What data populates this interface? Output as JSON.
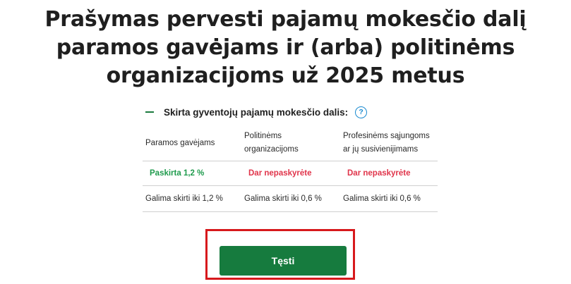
{
  "page": {
    "title_lines": [
      "Prašymas pervesti pajamų mokesčio dalį",
      "paramos gavėjams ir (arba) politinėms",
      "organizacijoms už 2025 metus"
    ]
  },
  "section": {
    "title": "Skirta gyventojų pajamų mokesčio dalis:",
    "help_icon_glyph": "?",
    "accent_color": "#1b7a3e"
  },
  "table": {
    "headers": [
      [
        "Paramos gavėjams"
      ],
      [
        "Politinėms",
        "organizacijoms"
      ],
      [
        "Profesinėms sąjungoms",
        "ar jų susivienijimams"
      ]
    ],
    "statuses": [
      {
        "text": "Paskirta 1,2 %",
        "color": "#1f9b4d"
      },
      {
        "text": "Dar nepaskyrėte",
        "color": "#e0344a"
      },
      {
        "text": "Dar nepaskyrėte",
        "color": "#e0344a"
      }
    ],
    "limits": [
      "Galima skirti iki 1,2 %",
      "Galima skirti iki 0,6 %",
      "Galima skirti iki 0,6 %"
    ]
  },
  "actions": {
    "continue_label": "Tęsti",
    "continue_color": "#167b3e",
    "highlight_color": "#d7191c"
  }
}
